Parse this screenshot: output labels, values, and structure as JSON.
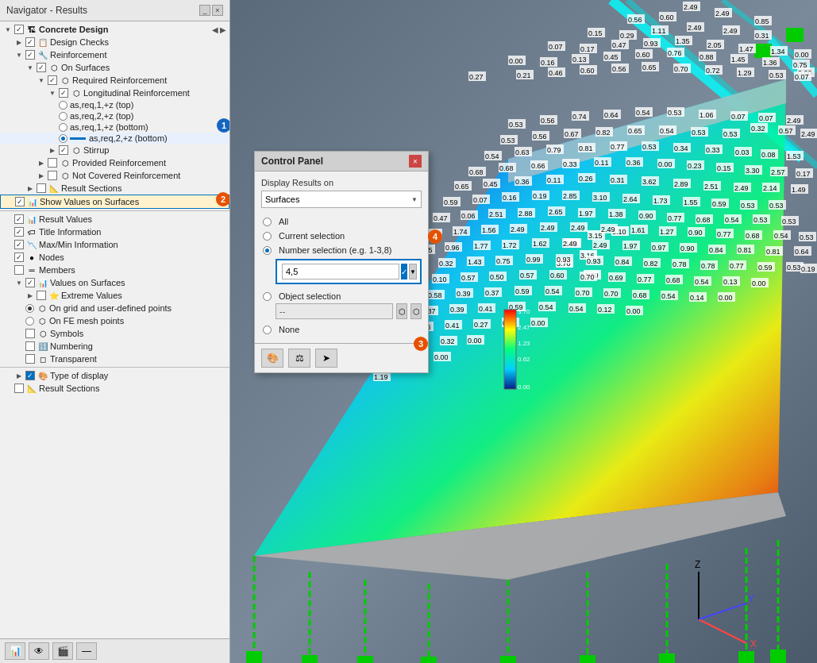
{
  "navigator": {
    "title": "Navigator - Results",
    "close_btn": "×",
    "tree": [
      {
        "id": "concrete-design",
        "label": "Concrete Design",
        "indent": 0,
        "type": "header",
        "expanded": true,
        "checked": "partial"
      },
      {
        "id": "design-checks",
        "label": "Design Checks",
        "indent": 1,
        "type": "checkbox",
        "expanded": false,
        "checked": true
      },
      {
        "id": "reinforcement",
        "label": "Reinforcement",
        "indent": 1,
        "type": "checkbox",
        "expanded": true,
        "checked": true
      },
      {
        "id": "on-surfaces",
        "label": "On Surfaces",
        "indent": 2,
        "type": "checkbox",
        "expanded": true,
        "checked": true
      },
      {
        "id": "required-reinforcement",
        "label": "Required Reinforcement",
        "indent": 3,
        "type": "checkbox",
        "expanded": true,
        "checked": true
      },
      {
        "id": "longitudinal-reinforcement",
        "label": "Longitudinal Reinforcement",
        "indent": 4,
        "type": "checkbox",
        "expanded": true,
        "checked": true
      },
      {
        "id": "as-req-1-top",
        "label": "as,req,1,+z (top)",
        "indent": 5,
        "type": "radio",
        "selected": false
      },
      {
        "id": "as-req-2-top",
        "label": "as,req,2,+z (top)",
        "indent": 5,
        "type": "radio",
        "selected": false
      },
      {
        "id": "as-req-1-bottom",
        "label": "as,req,1,+z (bottom)",
        "indent": 5,
        "type": "radio",
        "selected": false,
        "annotation": 1
      },
      {
        "id": "as-req-2-bottom",
        "label": "as,req,2,+z (bottom)",
        "indent": 5,
        "type": "radio-color",
        "selected": true,
        "color": "#0070c0"
      },
      {
        "id": "stirrup",
        "label": "Stirrup",
        "indent": 4,
        "type": "checkbox",
        "expanded": false,
        "checked": true
      },
      {
        "id": "provided-reinforcement",
        "label": "Provided Reinforcement",
        "indent": 3,
        "type": "checkbox",
        "expanded": false,
        "checked": false
      },
      {
        "id": "not-covered",
        "label": "Not Covered Reinforcement",
        "indent": 3,
        "type": "checkbox",
        "expanded": false,
        "checked": false
      },
      {
        "id": "result-sections",
        "label": "Result Sections",
        "indent": 2,
        "type": "checkbox",
        "expanded": false,
        "checked": false
      },
      {
        "id": "show-values",
        "label": "Show Values on Surfaces",
        "indent": 1,
        "type": "checkbox-highlighted",
        "expanded": false,
        "checked": true,
        "annotation": 2
      },
      {
        "id": "result-values",
        "label": "Result Values",
        "indent": 1,
        "type": "checkbox",
        "checked": true
      },
      {
        "id": "title-information",
        "label": "Title Information",
        "indent": 1,
        "type": "checkbox",
        "checked": true
      },
      {
        "id": "maxmin-information",
        "label": "Max/Min Information",
        "indent": 1,
        "type": "checkbox",
        "checked": true
      },
      {
        "id": "nodes",
        "label": "Nodes",
        "indent": 1,
        "type": "checkbox",
        "checked": true
      },
      {
        "id": "members",
        "label": "Members",
        "indent": 1,
        "type": "checkbox",
        "checked": false
      },
      {
        "id": "values-on-surfaces",
        "label": "Values on Surfaces",
        "indent": 1,
        "type": "checkbox-expanded",
        "expanded": true,
        "checked": true
      },
      {
        "id": "extreme-values",
        "label": "Extreme Values",
        "indent": 2,
        "type": "checkbox",
        "checked": false,
        "expanded": false
      },
      {
        "id": "on-grid",
        "label": "On grid and user-defined points",
        "indent": 2,
        "type": "radio-active",
        "selected": true
      },
      {
        "id": "on-fe-mesh",
        "label": "On FE mesh points",
        "indent": 2,
        "type": "radio",
        "selected": false
      },
      {
        "id": "symbols",
        "label": "Symbols",
        "indent": 2,
        "type": "checkbox",
        "checked": false
      },
      {
        "id": "numbering",
        "label": "Numbering",
        "indent": 2,
        "type": "checkbox",
        "checked": false
      },
      {
        "id": "transparent",
        "label": "Transparent",
        "indent": 2,
        "type": "checkbox",
        "checked": false
      },
      {
        "id": "type-of-display",
        "label": "Type of display",
        "indent": 1,
        "type": "checkbox",
        "checked": true,
        "expanded": false
      },
      {
        "id": "result-sections-2",
        "label": "Result Sections",
        "indent": 1,
        "type": "checkbox",
        "checked": false
      }
    ],
    "toolbar": {
      "btn1": "📊",
      "btn2": "👁",
      "btn3": "🎬",
      "btn4": "—"
    }
  },
  "control_panel": {
    "title": "Control Panel",
    "close": "×",
    "display_results_label": "Display Results on",
    "display_results_value": "Surfaces",
    "options": [
      {
        "id": "all",
        "label": "All",
        "selected": false
      },
      {
        "id": "current-selection",
        "label": "Current selection",
        "selected": false
      },
      {
        "id": "number-selection",
        "label": "Number selection (e.g. 1-3,8)",
        "selected": true
      },
      {
        "id": "object-selection",
        "label": "Object selection",
        "selected": false
      },
      {
        "id": "none",
        "label": "None",
        "selected": false
      }
    ],
    "number_input_value": "4,5",
    "object_field_value": "--",
    "footer_icons": [
      "🎨",
      "⚖",
      "➤"
    ],
    "annotation_3": "3",
    "annotation_4": "4"
  },
  "annotations": {
    "label_1": "1",
    "label_2": "2",
    "label_3": "3",
    "label_4": "4"
  }
}
